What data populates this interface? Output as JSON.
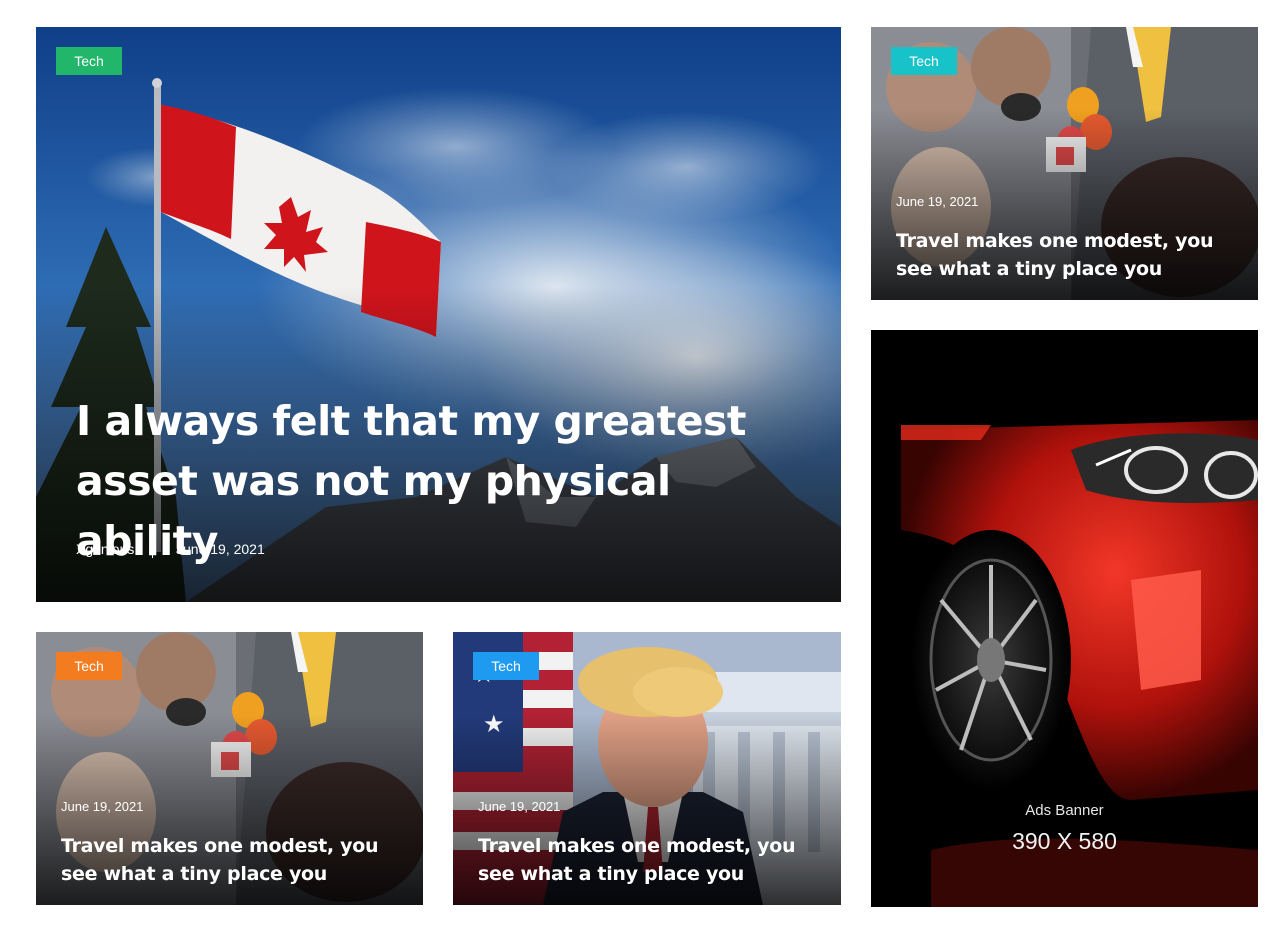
{
  "featured": {
    "category": "Tech",
    "category_color": "#21b66a",
    "title": "I always felt that my greatest asset was not my physical ability",
    "author": "Xgenious",
    "date": "June 19, 2021"
  },
  "posts": [
    {
      "category": "Tech",
      "category_color": "#17c3c8",
      "date": "June 19, 2021",
      "title": "Travel makes one modest, you see what a tiny place you"
    },
    {
      "category": "Tech",
      "category_color": "#f37b20",
      "date": "June 19, 2021",
      "title": "Travel makes one modest, you see what a tiny place you"
    },
    {
      "category": "Tech",
      "category_color": "#1e9bf0",
      "date": "June 19, 2021",
      "title": "Travel makes one modest, you see what a tiny place you"
    }
  ],
  "ad": {
    "label": "Ads Banner",
    "size": "390 X 580"
  }
}
